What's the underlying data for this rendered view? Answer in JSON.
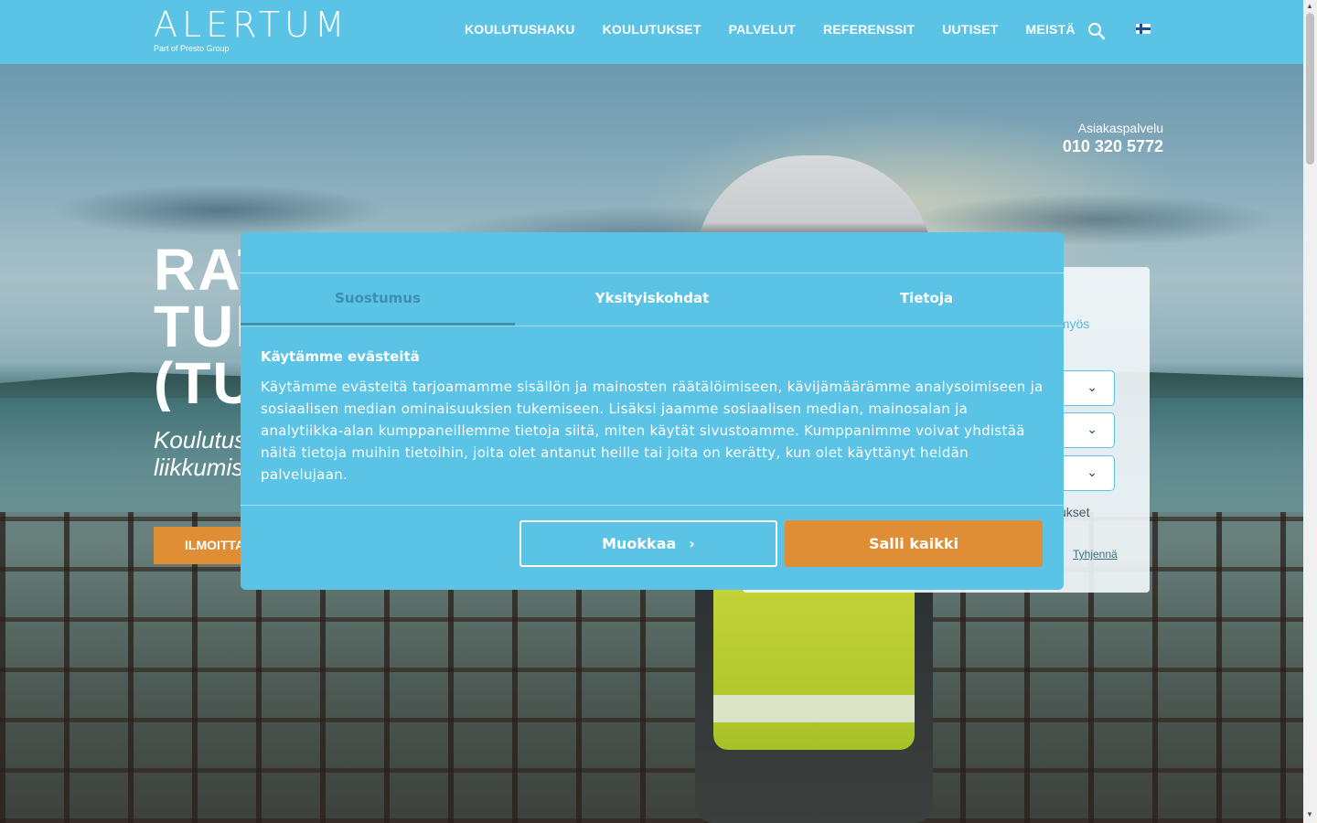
{
  "header": {
    "logo": "ALERTUM",
    "logo_sub": "Part of Presto Group",
    "nav": [
      "KOULUTUSHAKU",
      "KOULUTUKSET",
      "PALVELUT",
      "REFERENSSIT",
      "UUTISET",
      "MEISTÄ"
    ],
    "icons": [
      "search-icon",
      "finnish-flag-icon"
    ]
  },
  "service": {
    "label": "Asiakaspalvelu",
    "phone": "010 320 5772"
  },
  "hero": {
    "title_lines": [
      "RAT",
      "TUR",
      "(TU"
    ],
    "subtitle_lines": [
      "Koulutus",
      "liikkumis"
    ],
    "cta": "ILMOITTAUDU"
  },
  "search_panel": {
    "hint": "t myös",
    "checkbox_label": "ukset",
    "clear": "Tyhjennä"
  },
  "cookie_modal": {
    "tabs": [
      "Suostumus",
      "Yksityiskohdat",
      "Tietoja"
    ],
    "active_tab": "Suostumus",
    "title": "Käytämme evästeitä",
    "text": "Käytämme evästeitä tarjoamamme sisällön ja mainosten räätälöimiseen, kävijämäärämme analysoimiseen ja sosiaalisen median ominaisuuksien tukemiseen. Lisäksi jaamme sosiaalisen median, mainosalan ja analytiikka-alan kumppaneillemme tietoja siitä, miten käytät sivustoamme. Kumppanimme voivat yhdistää näitä tietoja muihin tietoihin, joita olet antanut heille tai joita on kerätty, kun olet käyttänyt heidän palvelujaan.",
    "btn_edit": "Muokkaa",
    "btn_allow": "Salli kaikki"
  },
  "colors": {
    "brand_blue": "#5ac3e6",
    "accent_orange": "#e08e35",
    "active_tab": "#3d8fae"
  }
}
